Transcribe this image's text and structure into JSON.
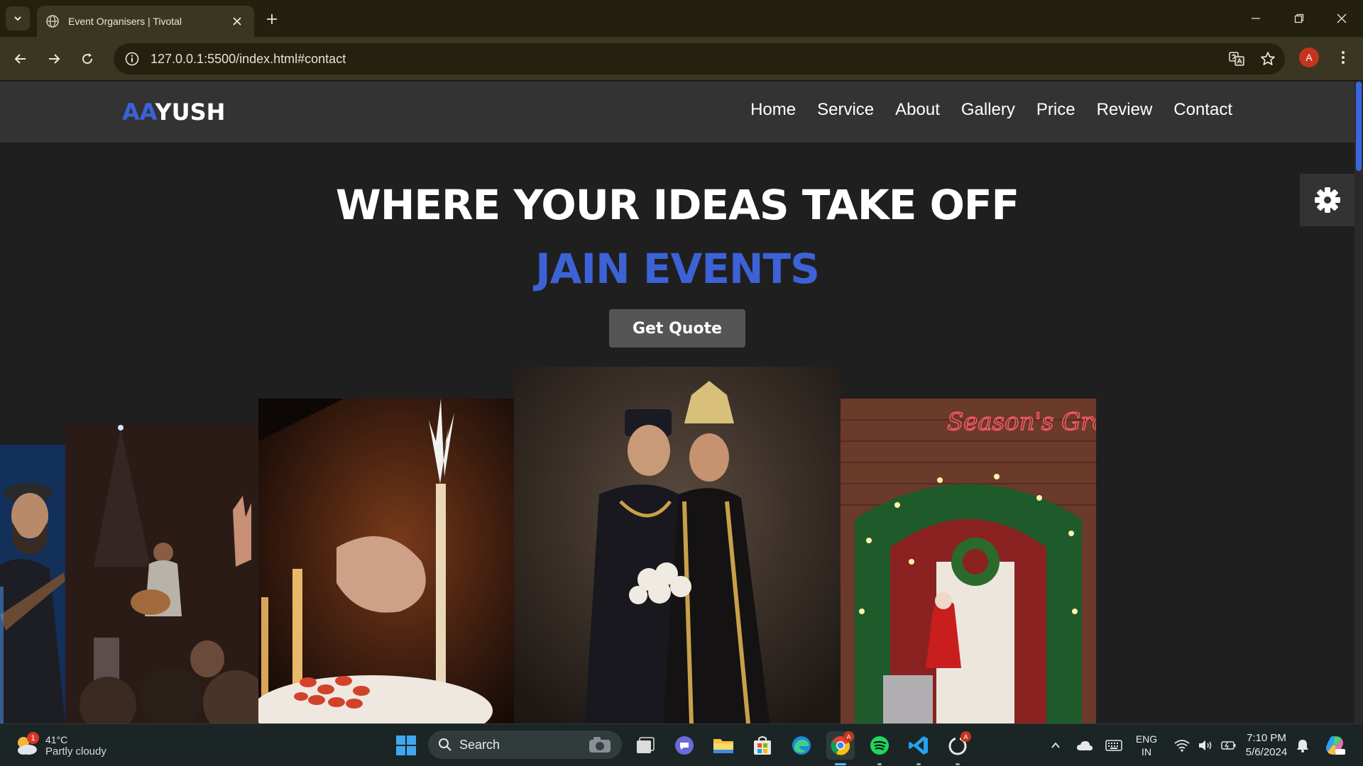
{
  "browser": {
    "tab_title": "Event Organisers | Tivotal",
    "url": "127.0.0.1:5500/index.html#contact",
    "profile_initial": "A"
  },
  "site": {
    "logo_accent": "AA",
    "logo_rest": "YUSH",
    "nav": [
      "Home",
      "Service",
      "About",
      "Gallery",
      "Price",
      "Review",
      "Contact"
    ],
    "hero_title": "WHERE YOUR IDEAS TAKE OFF",
    "hero_subtitle": "JAIN EVENTS",
    "cta_label": "Get Quote",
    "photo_overlay_text": "Season's Greetings",
    "colors": {
      "accent": "#3c62d6",
      "header_bg": "#333333",
      "page_bg": "#1f1f1f",
      "button_bg": "#555555"
    }
  },
  "taskbar": {
    "weather_temp": "41°C",
    "weather_condition": "Partly cloudy",
    "weather_badge": "1",
    "search_label": "Search",
    "lang_line1": "ENG",
    "lang_line2": "IN",
    "time": "7:10 PM",
    "date": "5/6/2024",
    "app_badge": "A"
  }
}
